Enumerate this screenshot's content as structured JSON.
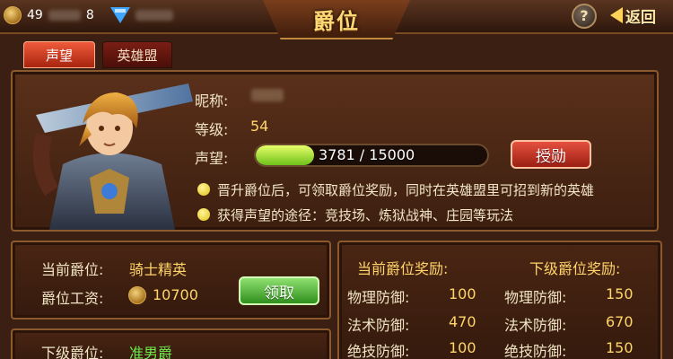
{
  "topbar": {
    "gold_prefix": "49",
    "gold_suffix": "8",
    "title": "爵位",
    "help_label": "?",
    "back_label": "返回"
  },
  "tabs": [
    {
      "label": "声望",
      "active": true
    },
    {
      "label": "英雄盟",
      "active": false
    }
  ],
  "profile": {
    "nickname_label": "昵称:",
    "level_label": "等级:",
    "level_value": "54",
    "reputation_label": "声望:",
    "reputation_text": "3781 / 15000",
    "reputation_current": 3781,
    "reputation_max": 15000,
    "award_button": "授勋",
    "bullets": [
      "晋升爵位后，可领取爵位奖励，同时在英雄盟里可招到新的英雄",
      "获得声望的途径：竞技场、炼狱战神、庄园等玩法"
    ]
  },
  "current": {
    "rank_label": "当前爵位:",
    "rank_value": "骑士精英",
    "salary_label": "爵位工资:",
    "salary_value": "10700",
    "claim_button": "领取"
  },
  "next": {
    "rank_label": "下级爵位:",
    "rank_value": "准男爵"
  },
  "rewards": {
    "current_header": "当前爵位奖励:",
    "next_header": "下级爵位奖励:",
    "rows": [
      {
        "label": "物理防御:",
        "current": "100",
        "next_label": "物理防御:",
        "next": "150"
      },
      {
        "label": "法术防御:",
        "current": "470",
        "next_label": "法术防御:",
        "next": "670"
      },
      {
        "label": "绝技防御:",
        "current": "100",
        "next_label": "绝技防御:",
        "next": "150"
      }
    ]
  },
  "colors": {
    "accent_yellow": "#ffd56a",
    "accent_green": "#6ee84a",
    "panel_brown": "#4a2513"
  }
}
